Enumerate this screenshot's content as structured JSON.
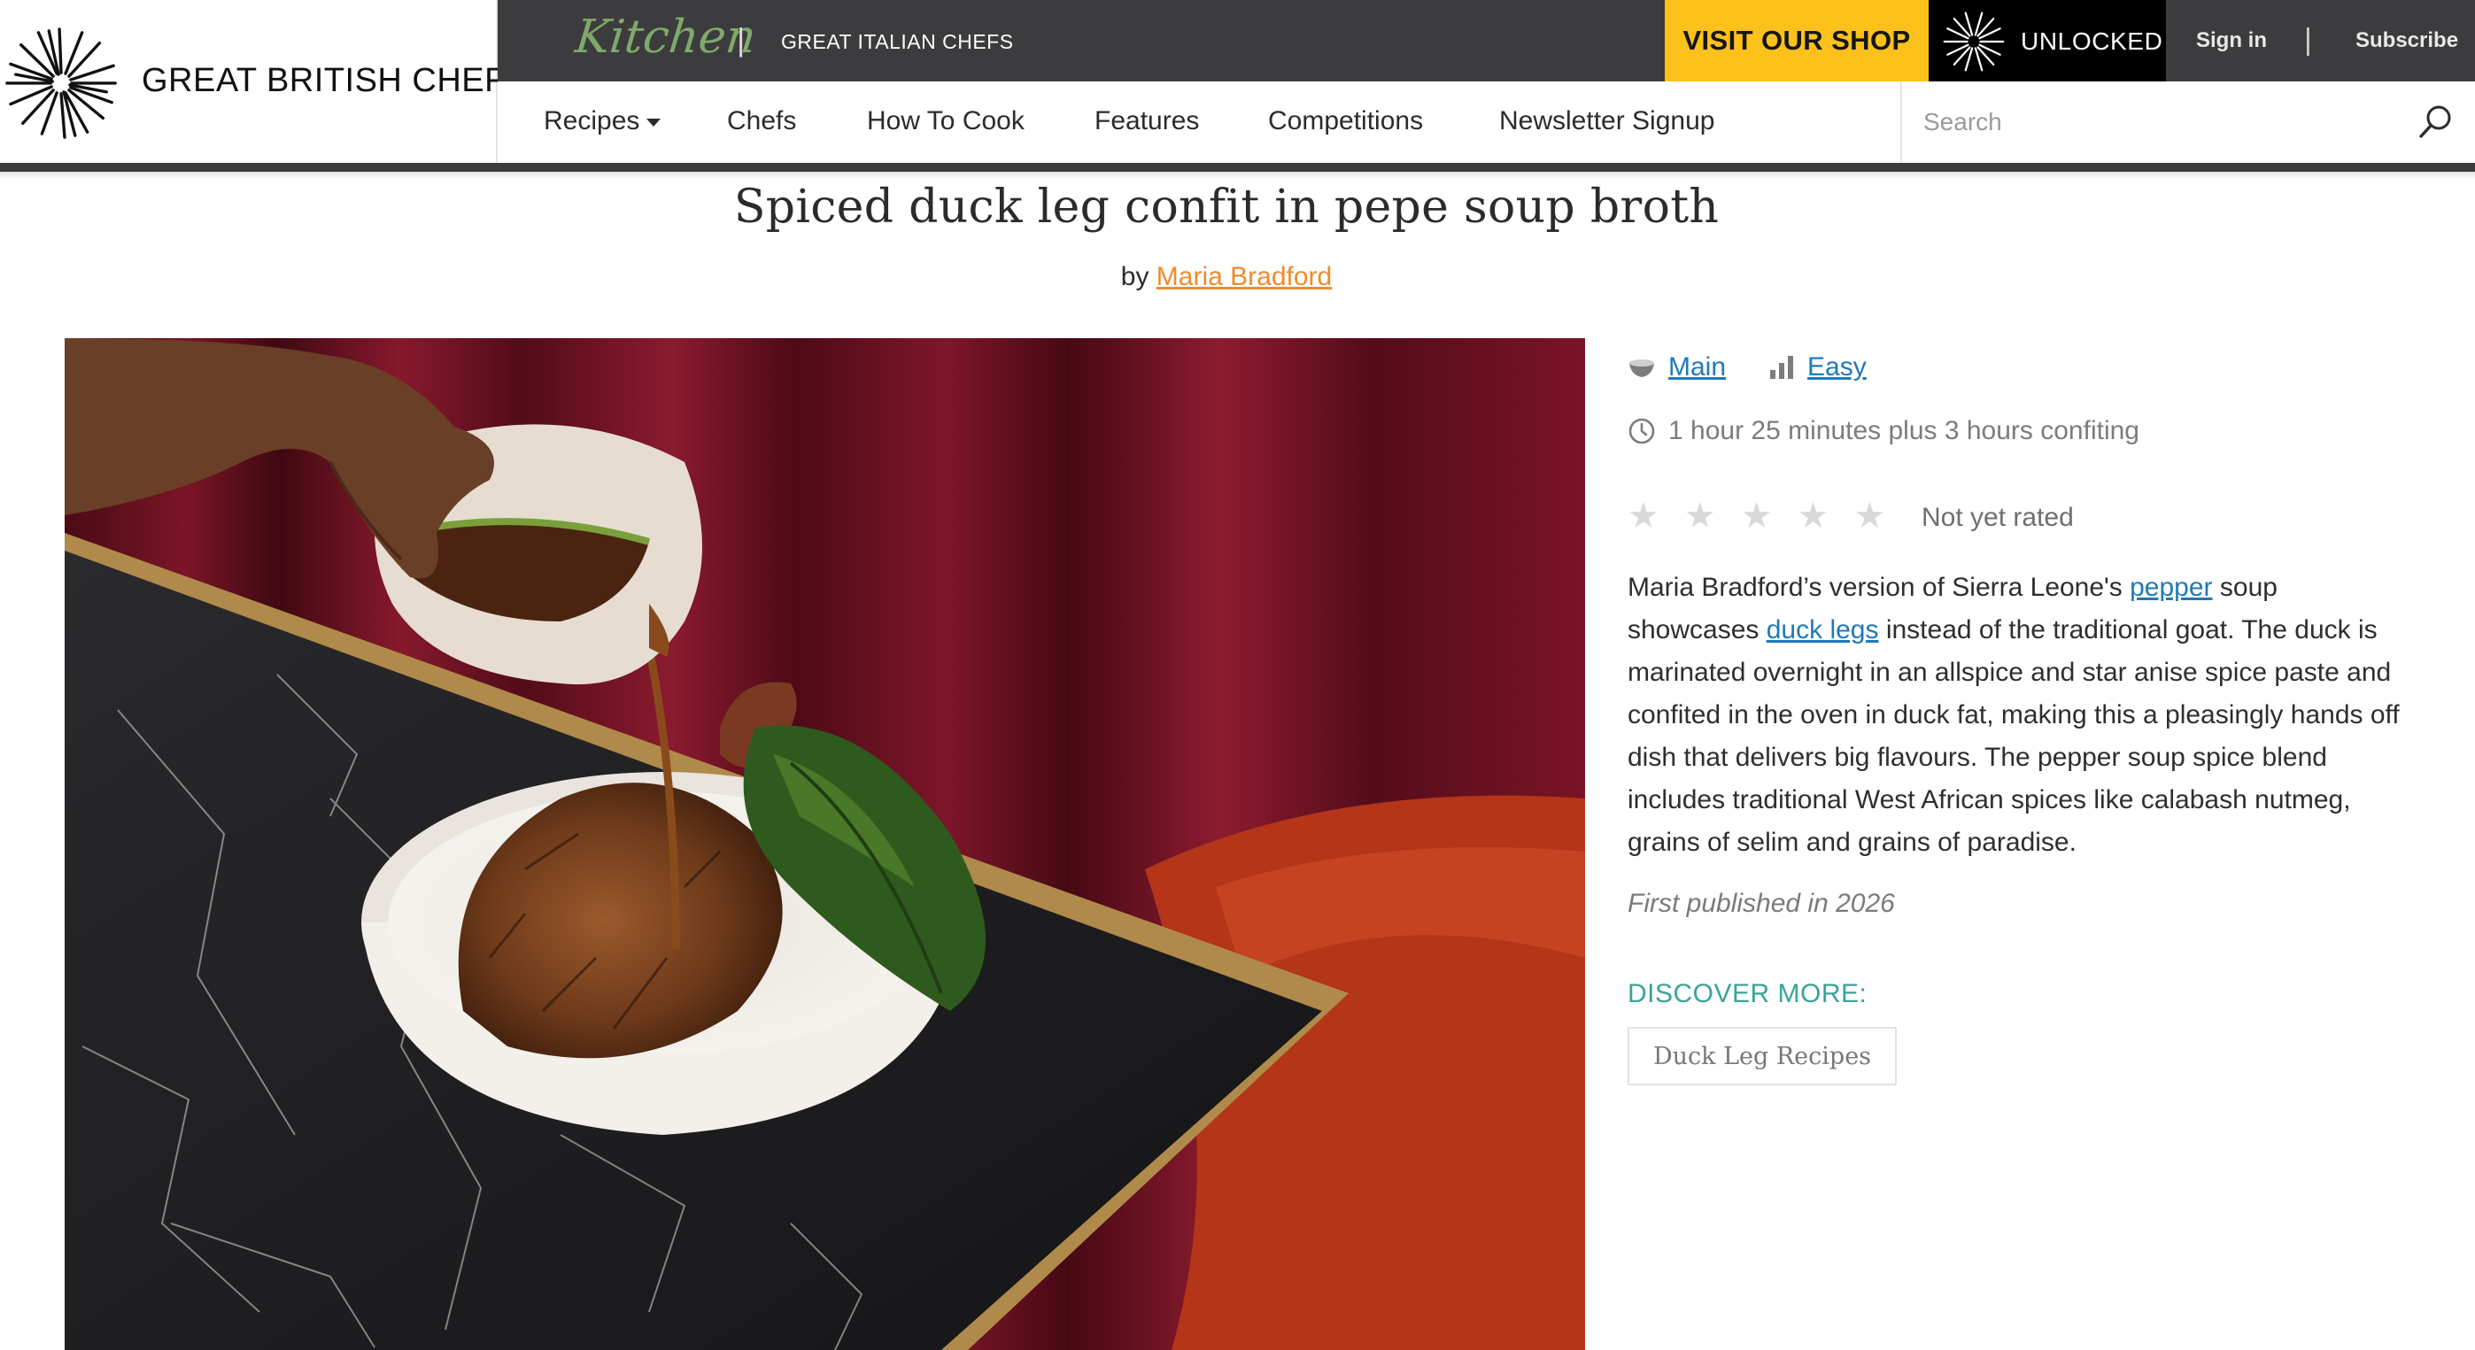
{
  "header": {
    "brand_name": "GREAT BRITISH CHEFS",
    "kitchen_logo": "Kitchen",
    "italian_link": "GREAT ITALIAN CHEFS",
    "shop_button": "VISIT OUR SHOP",
    "unlocked_label": "UNLOCKED",
    "sign_in": "Sign in",
    "separator": "|",
    "subscribe": "Subscribe"
  },
  "nav": {
    "items": [
      {
        "label": "Recipes"
      },
      {
        "label": "Chefs"
      },
      {
        "label": "How To Cook"
      },
      {
        "label": "Features"
      },
      {
        "label": "Competitions"
      },
      {
        "label": "Newsletter Signup"
      }
    ],
    "search_placeholder": "Search"
  },
  "recipe": {
    "title": "Spiced duck leg confit in pepe soup broth",
    "by_prefix": "by",
    "author": "Maria Bradford",
    "course": "Main",
    "difficulty": "Easy",
    "time": "1 hour 25 minutes plus 3 hours confiting",
    "rating_text": "Not yet rated",
    "stars_filled": 0,
    "stars_total": 5,
    "description": {
      "p1": "Maria Bradford’s version of Sierra Leone's ",
      "link1": "pepper",
      "p2": " soup showcases ",
      "link2": "duck legs",
      "p3": " instead of the traditional goat. The duck is marinated overnight in an allspice and star anise spice paste and confited in the oven in duck fat, making this a pleasingly hands off dish that delivers big flavours. The pepper soup spice blend includes traditional West African spices like calabash nutmeg, grains of selim and grains of paradise."
    },
    "published": "First published in 2026",
    "discover_heading": "DISCOVER MORE:",
    "discover_tag": "Duck Leg Recipes"
  },
  "colors": {
    "accent_orange": "#f08a2c",
    "link_blue": "#1f79b8",
    "shop_yellow": "#fdc11b",
    "teal": "#3aa39a",
    "dark_bar": "#3c3c3e"
  },
  "icons": {
    "course": "bowl-icon",
    "difficulty": "bars-icon",
    "time": "clock-icon",
    "search": "search-icon",
    "rating": "star-icon"
  }
}
